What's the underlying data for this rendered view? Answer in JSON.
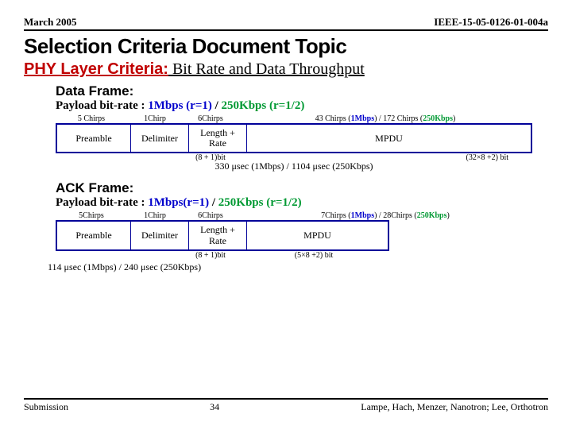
{
  "header": {
    "left": "March 2005",
    "right": "IEEE-15-05-0126-01-004a"
  },
  "title": "Selection Criteria Document Topic",
  "subtitle": {
    "label": "PHY Layer Criteria:",
    "rest": " Bit Rate and Data Throughput"
  },
  "data_frame": {
    "heading": "Data Frame:",
    "payload_prefix": "Payload bit-rate : ",
    "rate1": "1Mbps (r=1)",
    "sep": " / ",
    "rate2": "250Kbps (r=1/2)",
    "chirps": {
      "c1": "5 Chirps",
      "c2": "1Chirp",
      "c3": "6Chirps",
      "c4a": "43 Chirps (",
      "c4b": "1Mbps",
      "c4c": ") / 172 Chirps (",
      "c4d": "250Kbps",
      "c4e": ")"
    },
    "cells": {
      "preamble": "Preamble",
      "delimiter": "Delimiter",
      "lr": "Length + Rate",
      "mpdu": "MPDU"
    },
    "bits": {
      "b1": "(8 + 1)bit",
      "b2": "(32×8 +2) bit"
    },
    "timing": "330 μsec (1Mbps) / 1104 μsec (250Kbps)"
  },
  "ack_frame": {
    "heading": "ACK Frame:",
    "payload_prefix": "Payload bit-rate : ",
    "rate1": "1Mbps(r=1)",
    "sep": " / ",
    "rate2": "250Kbps (r=1/2)",
    "chirps": {
      "c1": "5Chirps",
      "c2": "1Chirp",
      "c3": "6Chirps",
      "c4a": "7Chirps (",
      "c4b": "1Mbps",
      "c4c": ") / 28Chirps (",
      "c4d": "250Kbps",
      "c4e": ")"
    },
    "cells": {
      "preamble": "Preamble",
      "delimiter": "Delimiter",
      "lr": "Length + Rate",
      "mpdu": "MPDU"
    },
    "bits": {
      "b1": "(8 + 1)bit",
      "b2": "(5×8 +2) bit"
    },
    "timing": "114 μsec (1Mbps) /  240 μsec (250Kbps)"
  },
  "footer": {
    "left": "Submission",
    "center": "34",
    "right": "Lampe, Hach, Menzer, Nanotron; Lee, Orthotron"
  }
}
